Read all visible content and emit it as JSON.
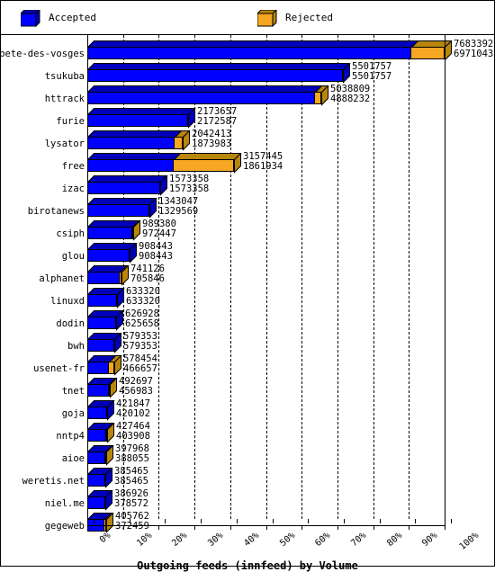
{
  "legend": {
    "accepted_label": "Accepted",
    "rejected_label": "Rejected",
    "accepted_color": "#0000ff",
    "rejected_color": "#f5a623"
  },
  "axis": {
    "xlabel": "Outgoing feeds (innfeed) by Volume",
    "ticks": [
      "0%",
      "10%",
      "20%",
      "30%",
      "40%",
      "50%",
      "60%",
      "70%",
      "80%",
      "90%",
      "100%"
    ]
  },
  "chart_data": {
    "type": "bar",
    "orientation": "horizontal",
    "stacked": true,
    "title": "",
    "xlabel": "Outgoing feeds (innfeed) by Volume",
    "ylabel": "",
    "xlim": [
      0,
      100
    ],
    "xtick_labels": [
      "0%",
      "10%",
      "20%",
      "30%",
      "40%",
      "50%",
      "60%",
      "70%",
      "80%",
      "90%",
      "100%"
    ],
    "grid": true,
    "legend_position": "top",
    "max_total": 7683392,
    "series": [
      {
        "name": "Accepted",
        "color": "#0000ff"
      },
      {
        "name": "Rejected",
        "color": "#f5a623"
      }
    ],
    "categories": [
      "bete-des-vosges",
      "tsukuba",
      "httrack",
      "furie",
      "lysator",
      "free",
      "izac",
      "birotanews",
      "csiph",
      "glou",
      "alphanet",
      "linuxd",
      "dodin",
      "bwh",
      "usenet-fr",
      "tnet",
      "goja",
      "nntp4",
      "aioe",
      "weretis.net",
      "niel.me",
      "gegeweb"
    ],
    "rows": [
      {
        "label": "bete-des-vosges",
        "total": 7683392,
        "accepted": 6971043
      },
      {
        "label": "tsukuba",
        "total": 5501757,
        "accepted": 5501757
      },
      {
        "label": "httrack",
        "total": 5038809,
        "accepted": 4888232
      },
      {
        "label": "furie",
        "total": 2173657,
        "accepted": 2172587
      },
      {
        "label": "lysator",
        "total": 2042413,
        "accepted": 1873983
      },
      {
        "label": "free",
        "total": 3157445,
        "accepted": 1861934
      },
      {
        "label": "izac",
        "total": 1573358,
        "accepted": 1573358
      },
      {
        "label": "birotanews",
        "total": 1343047,
        "accepted": 1329569
      },
      {
        "label": "csiph",
        "total": 989380,
        "accepted": 972447
      },
      {
        "label": "glou",
        "total": 908443,
        "accepted": 908443
      },
      {
        "label": "alphanet",
        "total": 741126,
        "accepted": 705846
      },
      {
        "label": "linuxd",
        "total": 633320,
        "accepted": 633320
      },
      {
        "label": "dodin",
        "total": 626928,
        "accepted": 625658
      },
      {
        "label": "bwh",
        "total": 579353,
        "accepted": 579353
      },
      {
        "label": "usenet-fr",
        "total": 578454,
        "accepted": 466657
      },
      {
        "label": "tnet",
        "total": 492697,
        "accepted": 456983
      },
      {
        "label": "goja",
        "total": 421847,
        "accepted": 420102
      },
      {
        "label": "nntp4",
        "total": 427464,
        "accepted": 403908
      },
      {
        "label": "aioe",
        "total": 397968,
        "accepted": 388055
      },
      {
        "label": "weretis.net",
        "total": 385465,
        "accepted": 385465
      },
      {
        "label": "niel.me",
        "total": 386926,
        "accepted": 378572
      },
      {
        "label": "gegeweb",
        "total": 405762,
        "accepted": 372459
      }
    ]
  }
}
